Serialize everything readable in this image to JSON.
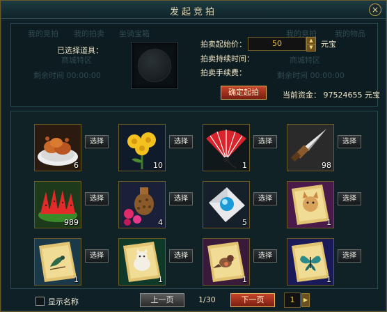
{
  "window": {
    "title": "发起竞拍",
    "close_glyph": "×"
  },
  "top": {
    "selected_label": "已选择道具：",
    "start_price_label": "拍卖起始价：",
    "start_price_value": "50",
    "currency": "元宝",
    "duration_label": "拍卖持续时间：",
    "fee_label": "拍卖手续费：",
    "confirm_label": "确定起拍",
    "funds_label": "当前资金：",
    "funds_value": "97524655",
    "funds_currency": "元宝",
    "ghost_texts": [
      "我的竞拍",
      "我的拍卖",
      "坐骑宝箱",
      "我的竞拍",
      "我的物品",
      "商城特区",
      "商城特区",
      "剩余时间 00:00:00",
      "剩余时间 00:00:00"
    ]
  },
  "grid": {
    "select_label": "选择",
    "items": [
      {
        "icon": "roast-crab-icon",
        "count": "6"
      },
      {
        "icon": "yellow-chrysanthemum-icon",
        "count": "10"
      },
      {
        "icon": "folding-fan-icon",
        "count": "1"
      },
      {
        "icon": "blade-tip-icon",
        "count": "98"
      },
      {
        "icon": "watermelon-slices-icon",
        "count": "989"
      },
      {
        "icon": "vase-and-orbs-icon",
        "count": "4"
      },
      {
        "icon": "pearl-on-cloth-icon",
        "count": "5"
      },
      {
        "icon": "dog-painting-scroll-icon",
        "count": "1"
      },
      {
        "icon": "bird-painting-scroll-icon",
        "count": "1"
      },
      {
        "icon": "cat-painting-scroll-icon",
        "count": "1"
      },
      {
        "icon": "sparrow-painting-scroll-icon",
        "count": "1"
      },
      {
        "icon": "butterfly-painting-scroll-icon",
        "count": "1"
      }
    ]
  },
  "footer": {
    "show_names_label": "显示名称",
    "prev_label": "上一页",
    "page_info": "1/30",
    "next_label": "下一页",
    "page_input": "1",
    "jump_glyph": "▶"
  },
  "colors": {
    "accent_gold": "#f2c23a",
    "button_red": "#c5442a",
    "frame_gold": "#6b5a22",
    "panel_teal": "#0f2126"
  }
}
